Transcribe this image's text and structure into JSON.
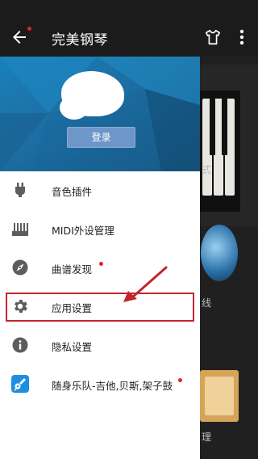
{
  "appbar": {
    "title": "完美钢琴",
    "back_icon": "arrow-left-icon",
    "shirt_icon": "tshirt-icon",
    "more_icon": "more-vertical-icon",
    "notification_dot_color": "#e5202f"
  },
  "drawer": {
    "header": {
      "login_label": "登录",
      "avatar": "avatar-icon"
    },
    "items": [
      {
        "label": "音色插件",
        "icon": "plugin-icon",
        "badge": false
      },
      {
        "label": "MIDI外设管理",
        "icon": "midi-keyboard-icon",
        "badge": false
      },
      {
        "label": "曲谱发现",
        "icon": "compass-icon",
        "badge": true
      },
      {
        "label": "应用设置",
        "icon": "gear-icon",
        "badge": false,
        "highlighted": true
      },
      {
        "label": "隐私设置",
        "icon": "info-icon",
        "badge": false
      },
      {
        "label": "随身乐队-吉他,贝斯,架子鼓",
        "icon": "guitar-app-icon",
        "badge": true
      }
    ]
  },
  "background": {
    "labels": [
      "式",
      "线",
      "理"
    ]
  },
  "colors": {
    "highlight": "#c0262d",
    "header_blue": "#1c6ea3",
    "badge": "#e5202f"
  }
}
